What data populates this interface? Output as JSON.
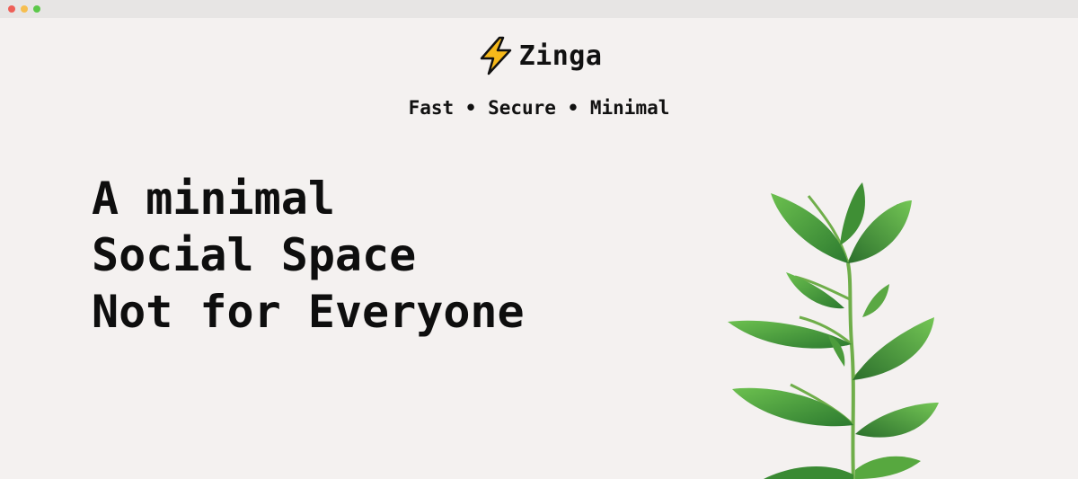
{
  "window": {
    "controls": {
      "close_color": "#ee5f57",
      "minimize_color": "#f6be4f",
      "maximize_color": "#5cc84a"
    }
  },
  "brand": {
    "name": "Zinga",
    "logo_icon": "lightning-bolt-icon",
    "logo_color": "#f6b91a"
  },
  "tagline": "Fast • Secure • Minimal",
  "hero": {
    "lines": [
      "A minimal",
      "Social Space",
      "Not for Everyone"
    ]
  },
  "decor": {
    "plant_icon": "plant-illustration"
  },
  "colors": {
    "background": "#f4f1f0",
    "text": "#111111",
    "leaf_dark": "#2f7d32",
    "leaf_light": "#5fb547"
  }
}
